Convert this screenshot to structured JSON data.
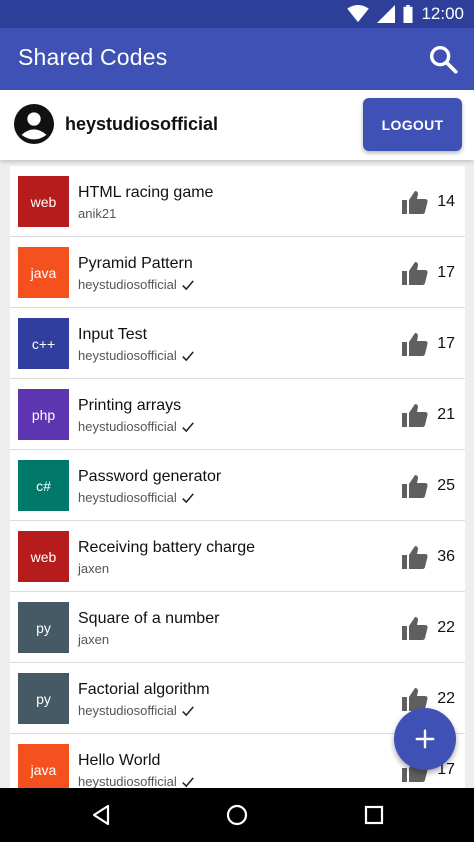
{
  "status": {
    "time": "12:00"
  },
  "appbar": {
    "title": "Shared Codes"
  },
  "user": {
    "name": "heystudiosofficial",
    "logout_label": "LOGOUT"
  },
  "codes": [
    {
      "lang": "web",
      "color": "#b71c1c",
      "title": "HTML racing game",
      "author": "anik21",
      "verified": false,
      "likes": "14"
    },
    {
      "lang": "java",
      "color": "#f4511e",
      "title": "Pyramid Pattern",
      "author": "heystudiosofficial",
      "verified": true,
      "likes": "17"
    },
    {
      "lang": "c++",
      "color": "#303f9f",
      "title": "Input Test",
      "author": "heystudiosofficial",
      "verified": true,
      "likes": "17"
    },
    {
      "lang": "php",
      "color": "#5e35b1",
      "title": "Printing arrays",
      "author": "heystudiosofficial",
      "verified": true,
      "likes": "21"
    },
    {
      "lang": "c#",
      "color": "#00796b",
      "title": "Password generator",
      "author": "heystudiosofficial",
      "verified": true,
      "likes": "25"
    },
    {
      "lang": "web",
      "color": "#b71c1c",
      "title": "Receiving battery charge",
      "author": "jaxen",
      "verified": false,
      "likes": "36"
    },
    {
      "lang": "py",
      "color": "#455a64",
      "title": "Square of a number",
      "author": "jaxen",
      "verified": false,
      "likes": "22"
    },
    {
      "lang": "py",
      "color": "#455a64",
      "title": "Factorial algorithm",
      "author": "heystudiosofficial",
      "verified": true,
      "likes": "22"
    },
    {
      "lang": "java",
      "color": "#f4511e",
      "title": "Hello World",
      "author": "heystudiosofficial",
      "verified": true,
      "likes": "17"
    }
  ],
  "colors": {
    "primary": "#3f51b5",
    "primary_dark": "#2e3f9a",
    "like_icon": "#5f5f5f"
  },
  "icons": {
    "search": "search-icon",
    "avatar": "account-circle-icon",
    "like": "thumb-up-icon",
    "verified": "check-icon",
    "fab": "add-icon",
    "back": "back-icon",
    "home": "home-icon",
    "recents": "recents-icon"
  }
}
